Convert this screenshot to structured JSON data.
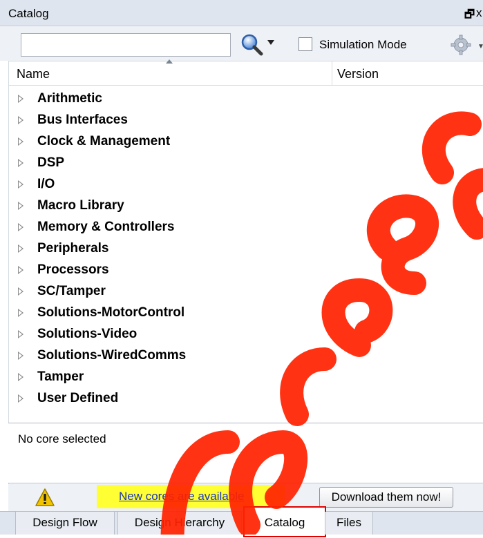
{
  "window": {
    "title": "Catalog",
    "restore_glyph": "🗗",
    "close_glyph": "x"
  },
  "toolbar": {
    "search_value": "",
    "search_placeholder": "",
    "simulation_mode_label": "Simulation Mode",
    "simulation_mode_checked": false,
    "icons": [
      "search-icon",
      "chevron-down-icon",
      "gear-icon"
    ]
  },
  "columns": {
    "name": "Name",
    "version": "Version"
  },
  "tree": {
    "items": [
      {
        "label": "Arithmetic"
      },
      {
        "label": "Bus Interfaces"
      },
      {
        "label": "Clock & Management"
      },
      {
        "label": "DSP"
      },
      {
        "label": "I/O"
      },
      {
        "label": "Macro Library"
      },
      {
        "label": "Memory & Controllers"
      },
      {
        "label": "Peripherals"
      },
      {
        "label": "Processors"
      },
      {
        "label": "SC/Tamper"
      },
      {
        "label": "Solutions-MotorControl"
      },
      {
        "label": "Solutions-Video"
      },
      {
        "label": "Solutions-WiredComms"
      },
      {
        "label": "Tamper"
      },
      {
        "label": "User Defined"
      }
    ]
  },
  "description": {
    "text": "No core selected"
  },
  "notification": {
    "link_text": "New cores are available",
    "button_label": "Download them now!",
    "icon": "warning-icon"
  },
  "tabs": [
    {
      "label": "Design Flow",
      "active": false
    },
    {
      "label": "Design Hierarchy",
      "active": false
    },
    {
      "label": "Catalog",
      "active": true
    },
    {
      "label": "Files",
      "active": false
    }
  ],
  "colors": {
    "highlight": "#ffff33",
    "link": "#1a35b8",
    "active_tab_outline": "#e00000",
    "watermark": "#ff2200"
  }
}
